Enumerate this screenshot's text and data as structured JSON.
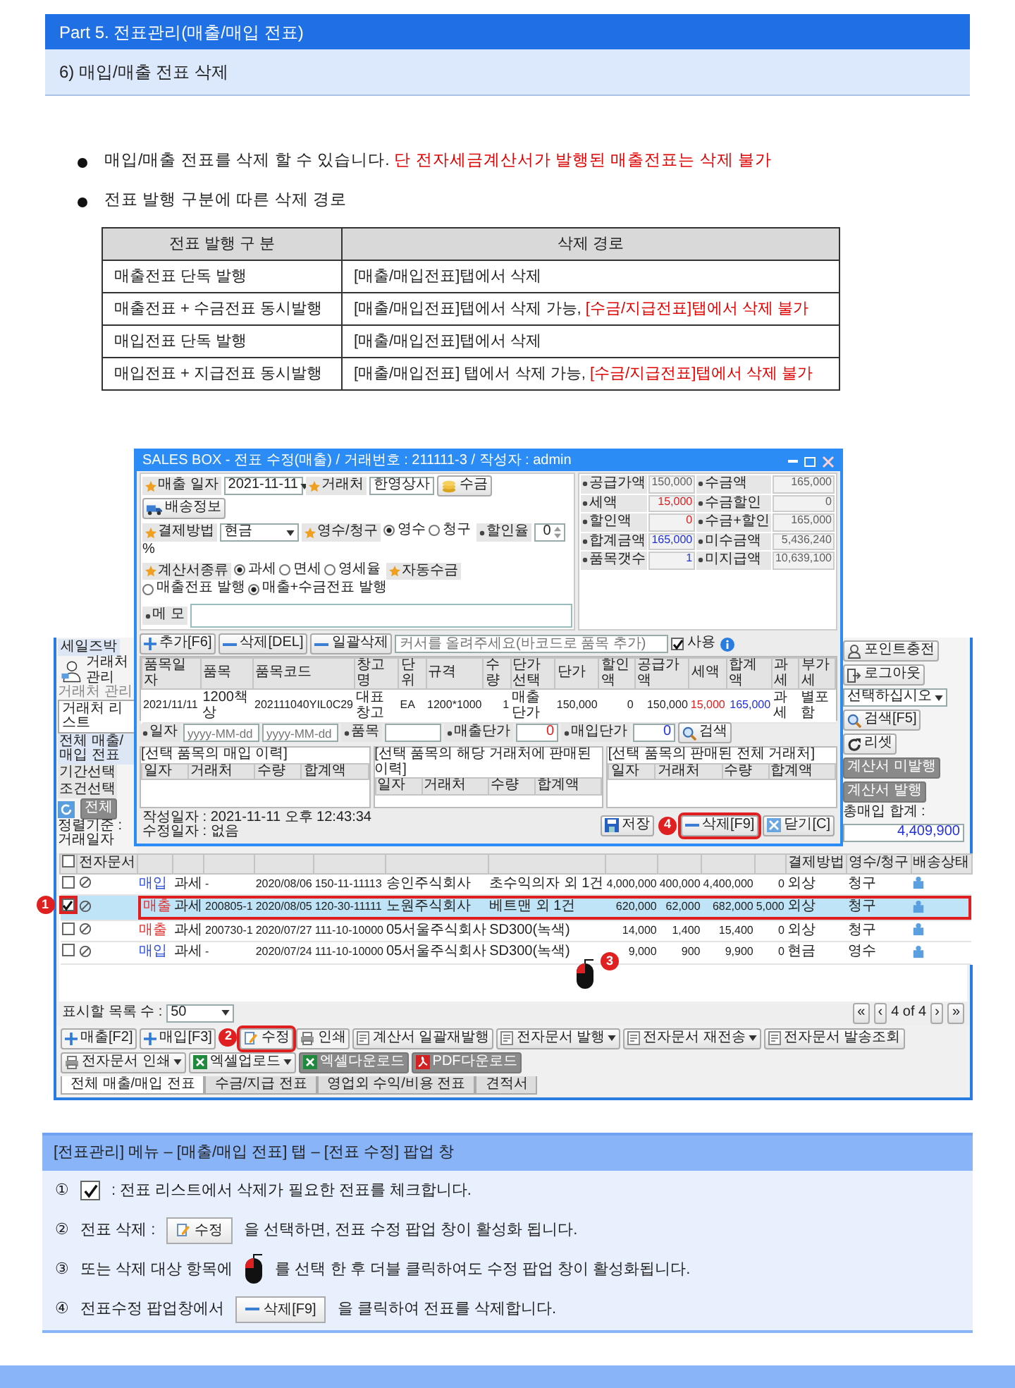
{
  "doc": {
    "part_title": "Part 5. 전표관리(매출/매입 전표)",
    "section_title": "6) 매입/매출 전표 삭제"
  },
  "bullets": [
    {
      "parts": [
        {
          "text": "매입/매출 전표를 삭제 할 수 있습니다. ",
          "warn": false
        },
        {
          "text": "단 전자세금계산서가 발행된 매출전표는 삭제 불가",
          "warn": true
        }
      ]
    },
    {
      "parts": [
        {
          "text": "전표 발행 구분에 따른 삭제 경로",
          "warn": false
        }
      ]
    }
  ],
  "route_table": {
    "columns": [
      "전표 발행 구 분",
      "삭제 경로"
    ],
    "rows": [
      {
        "type": "매출전표 단독 발행",
        "route": [
          {
            "text": "[매출/매입전표]탭에서 삭제",
            "warn": false
          }
        ]
      },
      {
        "type": "매출전표 + 수금전표 동시발행",
        "route": [
          {
            "text": "[매출/매입전표]탭에서 삭제 가능, ",
            "warn": false
          },
          {
            "text": "[수금/지급전표]탭에서 삭제 불가",
            "warn": true
          }
        ]
      },
      {
        "type": "매입전표 단독 발행",
        "route": [
          {
            "text": "[매출/매입전표]탭에서 삭제",
            "warn": false
          }
        ]
      },
      {
        "type": "매입전표 + 지급전표 동시발행",
        "route": [
          {
            "text": "[매출/매입전표] 탭에서 삭제 가능, ",
            "warn": false
          },
          {
            "text": "[수금/지급전표]탭에서 삭제 불가",
            "warn": true
          }
        ]
      }
    ]
  },
  "app": {
    "popup": {
      "title": "SALES BOX - 전표 수정(매출) / 거래번호 : 211111-3 / 작성자 : admin",
      "form_rows": [
        [
          {
            "kind": "label",
            "text": "매출 일자",
            "required": true
          },
          {
            "kind": "select",
            "value": "2021-11-11"
          },
          {
            "kind": "label",
            "text": "거래처",
            "required": true
          },
          {
            "kind": "input",
            "value": "한영상사"
          },
          {
            "kind": "collect",
            "text": "수금"
          },
          {
            "kind": "shipping",
            "text": "배송정보"
          }
        ],
        [
          {
            "kind": "label",
            "text": "결제방법",
            "required": true
          },
          {
            "kind": "select",
            "value": "현금"
          },
          {
            "kind": "label",
            "text": "영수/청구",
            "required": true
          },
          {
            "kind": "radios",
            "options": [
              {
                "text": "영수",
                "selected": true
              },
              {
                "text": "청구",
                "selected": false
              }
            ]
          },
          {
            "kind": "label",
            "text": "할인율",
            "required": false
          },
          {
            "kind": "spin",
            "value": "0"
          },
          {
            "kind": "unit",
            "text": "%"
          }
        ],
        [
          {
            "kind": "label",
            "text": "계산서종류",
            "required": true
          },
          {
            "kind": "radios",
            "options": [
              {
                "text": "과세",
                "selected": true
              },
              {
                "text": "면세",
                "selected": false
              },
              {
                "text": "영세율",
                "selected": false
              }
            ]
          },
          {
            "kind": "label",
            "text": "자동수금",
            "required": true
          },
          {
            "kind": "radios",
            "options": [
              {
                "text": "매출전표 발행",
                "selected": false
              },
              {
                "text": "매출+수금전표 발행",
                "selected": true
              }
            ]
          }
        ],
        [
          {
            "kind": "label",
            "text": "메 모",
            "required": false
          },
          {
            "kind": "memo"
          }
        ]
      ],
      "totals": [
        {
          "label": "공급가액",
          "value": "150,000",
          "color": "#606060"
        },
        {
          "label": "수금액",
          "value": "165,000",
          "color": "#606060"
        },
        {
          "label": "세액",
          "value": "15,000",
          "color": "#e02020"
        },
        {
          "label": "수금할인",
          "value": "0",
          "color": "#606060"
        },
        {
          "label": "할인액",
          "value": "0",
          "color": "#e02020"
        },
        {
          "label": "수금+할인",
          "value": "165,000",
          "color": "#606060"
        },
        {
          "label": "합계금액",
          "value": "165,000",
          "color": "#2030e0"
        },
        {
          "label": "미수금액",
          "value": "5,436,240",
          "color": "#606060"
        },
        {
          "label": "품목갯수",
          "value": "1",
          "color": "#2030e0"
        },
        {
          "label": "미지급액",
          "value": "10,639,100",
          "color": "#606060"
        }
      ],
      "toolbar": {
        "buttons": [
          "추가[F6]",
          "삭제[DEL]",
          "일괄삭제"
        ],
        "barcode_placeholder": "커서를 올려주세요(바코드로 품목 추가)",
        "use": {
          "label": "사용",
          "checked": true
        }
      },
      "items": {
        "columns": [
          {
            "text": "품목일자"
          },
          {
            "text": "품목"
          },
          {
            "text": "품목코드"
          },
          {
            "text": "창고명"
          },
          {
            "text": "단위"
          },
          {
            "text": "규격"
          },
          {
            "text": "수량"
          },
          {
            "text": "단가선택"
          },
          {
            "text": "단가"
          },
          {
            "text": "할인액"
          },
          {
            "text": "공급가액"
          },
          {
            "text": "세액",
            "color": "#e02020"
          },
          {
            "text": "합계액",
            "color": "#2030e0"
          },
          {
            "text": "과세"
          },
          {
            "text": "부가세"
          }
        ],
        "rows": [
          [
            "2021/11/11",
            "1200책상",
            "202111040YIL0C29",
            "대표창고",
            "EA",
            "1200*1000",
            "1",
            "매출단가",
            "150,000",
            "0",
            "150,000",
            "15,000",
            "165,000",
            "과세",
            "별포함"
          ]
        ]
      },
      "filter": {
        "date_label": "일자",
        "date_from_placeholder": "yyyy-MM-dd",
        "date_to_placeholder": "yyyy-MM-dd",
        "item_label": "품목",
        "sale_label": "매출단가",
        "sale_value": "0",
        "buy_label": "매입단가",
        "buy_value": "0",
        "search": "검색"
      },
      "panels": [
        {
          "title": "[선택 품목의 매입 이력]",
          "columns": [
            "일자",
            "거래처",
            "수량",
            "합계액"
          ]
        },
        {
          "title": "[선택 품목의 해당 거래처에 판매된 이력]",
          "columns": [
            "일자",
            "거래처",
            "수량",
            "합계액"
          ]
        },
        {
          "title": "[선택 품목의 판매된 전체 거래처]",
          "columns": [
            "일자",
            "거래처",
            "수량",
            "합계액"
          ]
        }
      ],
      "stamps": [
        "작성일자 : 2021-11-11 오후 12:43:34",
        "수정일자 : 없음"
      ],
      "footer_buttons": [
        {
          "text": "저장",
          "highlight": false
        },
        {
          "text": "삭제[F9]",
          "highlight": true,
          "callout": "4"
        },
        {
          "text": "닫기[C]",
          "highlight": false
        }
      ]
    },
    "main": {
      "left": {
        "ribbon_tab": "세일즈박",
        "group_button": "거래처 관리",
        "group_caption": "거래처 관리",
        "doc_tab": "거래처 리스트",
        "section": "전체 매출/매입 전표",
        "filters": [
          "기간선택",
          "조건선택"
        ],
        "all_button": "전체",
        "sort": "정렬기준 : 거래일자"
      },
      "right": {
        "ribbon_buttons": [
          "포인트충전",
          "로그아웃"
        ],
        "select": "선택하십시오",
        "search": "검색[F5]",
        "reset": "리셋",
        "invoice_buttons": [
          "계산서 미발행",
          "계산서 발행"
        ],
        "total_label": "총매입 합계 :",
        "total_value": "4,409,900"
      },
      "list": {
        "all_checked": false,
        "header_left": [
          "전자문서"
        ],
        "header_right": [
          "결제방법",
          "영수/청구",
          "배송상태"
        ],
        "rows": [
          {
            "checked": false,
            "selected": false,
            "highlight": false,
            "kind": "purchase",
            "cells": [
              "매입",
              "과세",
              "-",
              "2020/08/06",
              "150-11-11113",
              "송인주식회사",
              "초수익의자 외 1건",
              "4,000,000",
              "400,000",
              "4,400,000",
              "0",
              "외상",
              "청구"
            ]
          },
          {
            "checked": true,
            "selected": true,
            "highlight": true,
            "callout": "1",
            "kind": "sale",
            "cells": [
              "매출",
              "과세",
              "200805-1",
              "2020/08/05",
              "120-30-11111",
              "노원주식회사",
              "베트맨 외 1건",
              "620,000",
              "62,000",
              "682,000",
              "5,000",
              "외상",
              "청구"
            ]
          },
          {
            "checked": false,
            "selected": false,
            "highlight": false,
            "kind": "sale",
            "cells": [
              "매출",
              "과세",
              "200730-1",
              "2020/07/27",
              "111-10-10000",
              "05서울주식회사",
              "SD300(녹색)",
              "14,000",
              "1,400",
              "15,400",
              "0",
              "외상",
              "청구"
            ]
          },
          {
            "checked": false,
            "selected": false,
            "highlight": false,
            "kind": "purchase",
            "cells": [
              "매입",
              "과세",
              "-",
              "2020/07/24",
              "111-10-10000",
              "05서울주식회사",
              "SD300(녹색)",
              "9,000",
              "900",
              "9,900",
              "0",
              "현금",
              "영수"
            ]
          }
        ]
      },
      "mouse_callout": "3",
      "pager": {
        "label": "표시할 목록 수 :",
        "value": "50",
        "first": "«",
        "prev": "‹",
        "page": "4 of 4",
        "next": "›",
        "last": "»"
      },
      "actions": [
        {
          "text": "매출[F2]",
          "kind": "plain",
          "dropdown": false,
          "highlight": false
        },
        {
          "text": "매입[F3]",
          "kind": "plain",
          "dropdown": false,
          "highlight": false
        },
        {
          "text": "수정",
          "kind": "plain",
          "dropdown": false,
          "highlight": true,
          "callout": "2"
        },
        {
          "text": "인쇄",
          "kind": "plain",
          "dropdown": false,
          "highlight": false
        },
        {
          "text": "계산서 일괄재발행",
          "kind": "light",
          "dropdown": false,
          "highlight": false
        },
        {
          "text": "전자문서 발행",
          "kind": "light",
          "dropdown": true,
          "highlight": false
        },
        {
          "text": "전자문서 재전송",
          "kind": "light",
          "dropdown": true,
          "highlight": false
        },
        {
          "text": "전자문서 발송조회",
          "kind": "light",
          "dropdown": false,
          "highlight": false
        },
        {
          "text": "전자문서 인쇄",
          "kind": "light",
          "dropdown": true,
          "highlight": false
        },
        {
          "text": "엑셀업로드",
          "kind": "light",
          "dropdown": true,
          "highlight": false
        },
        {
          "text": "엑셀다운로드",
          "kind": "dark",
          "dropdown": false,
          "highlight": false
        },
        {
          "text": "PDF다운로드",
          "kind": "dark",
          "dropdown": false,
          "highlight": false
        }
      ],
      "tabs": [
        {
          "text": "전체 매출/매입 전표",
          "selected": true
        },
        {
          "text": "수금/지급 전표",
          "selected": false
        },
        {
          "text": "영업외 수익/비용 전표",
          "selected": false
        },
        {
          "text": "견적서",
          "selected": false
        }
      ]
    }
  },
  "info": {
    "title": "[전표관리] 메뉴 – [매출/매입 전표] 탭 – [전표 수정] 팝업 창",
    "steps": [
      {
        "num": "①",
        "parts": [
          {
            "kind": "checkbox",
            "checked": true
          },
          {
            "kind": "text",
            "text": ": 전표 리스트에서 삭제가 필요한 전표를 체크합니다."
          }
        ]
      },
      {
        "num": "②",
        "parts": [
          {
            "kind": "text",
            "text": "전표 삭제 :"
          },
          {
            "kind": "edit_button",
            "text": "수정"
          },
          {
            "kind": "text",
            "text": "을 선택하면, 전표 수정 팝업 창이 활성화 됩니다."
          }
        ]
      },
      {
        "num": "③",
        "parts": [
          {
            "kind": "text",
            "text": "또는 삭제 대상 항목에"
          },
          {
            "kind": "mouse"
          },
          {
            "kind": "text",
            "text": "를 선택 한 후 더블 클릭하여도 수정 팝업 창이 활성화됩니다."
          }
        ]
      },
      {
        "num": "④",
        "parts": [
          {
            "kind": "text",
            "text": "전표수정 팝업창에서"
          },
          {
            "kind": "delete_button",
            "text": "삭제[F9]"
          },
          {
            "kind": "text",
            "text": "을 클릭하여 전표를 삭제합니다."
          }
        ]
      }
    ]
  }
}
